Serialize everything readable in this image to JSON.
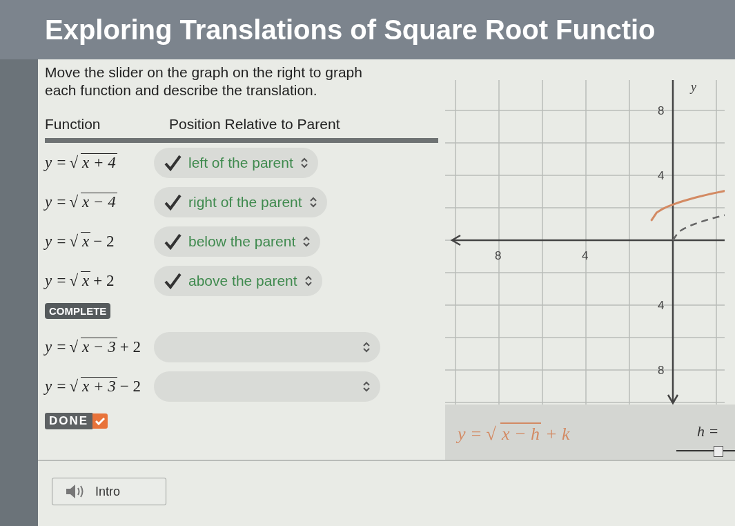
{
  "title": "Exploring Translations of Square Root Functio",
  "instructions": [
    "Move the slider on the graph on the right to graph",
    "each function and describe the translation."
  ],
  "table": {
    "columns": [
      "Function",
      "Position Relative to Parent"
    ],
    "rows": [
      {
        "function": {
          "before": "y =",
          "root": "√",
          "radicand": "x + 4"
        },
        "answer": "left of the parent",
        "correct": true
      },
      {
        "function": {
          "before": "y =",
          "root": "√",
          "radicand": "x − 4"
        },
        "answer": "right of the parent",
        "correct": true
      },
      {
        "function": {
          "before": "y =",
          "root": "√",
          "radicand": "x",
          "after": "− 2"
        },
        "answer": "below the parent",
        "correct": true
      },
      {
        "function": {
          "before": "y =",
          "root": "√",
          "radicand": "x",
          "after": "+ 2"
        },
        "answer": "above the parent",
        "correct": true
      }
    ]
  },
  "complete_badge": "COMPLETE",
  "extra_rows": [
    {
      "function": {
        "before": "y =",
        "root": "√",
        "radicand": "x − 3",
        "after": "+ 2"
      },
      "correct": false
    },
    {
      "function": {
        "before": "y =",
        "root": "√",
        "radicand": "x + 3",
        "after": "− 2"
      },
      "correct": false
    }
  ],
  "done": {
    "label": "DONE",
    "checked": true
  },
  "graph": {
    "axis_label": "y",
    "x_tick_labels": [
      "8",
      "4"
    ],
    "y_tick_labels": [
      "8",
      "4",
      "4",
      "8"
    ],
    "equation": {
      "before": "y =",
      "root": "√",
      "radicand": "x − h",
      "after": "+ k"
    },
    "slider": {
      "label": "h =",
      "level": 0.7
    }
  },
  "intro_button": "Intro"
}
